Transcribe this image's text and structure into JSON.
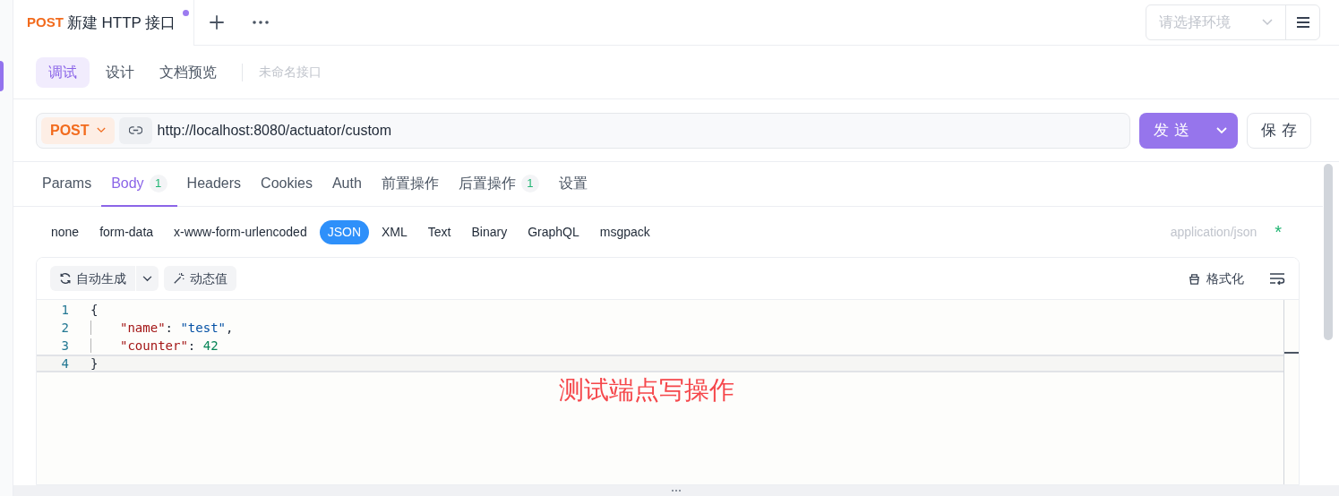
{
  "request_tab": {
    "method": "POST",
    "title": "新建 HTTP 接口",
    "unsaved": true
  },
  "env_select": {
    "placeholder": "请选择环境"
  },
  "mode_tabs": [
    {
      "label": "调试",
      "selected": true
    },
    {
      "label": "设计",
      "selected": false
    },
    {
      "label": "文档预览",
      "selected": false
    }
  ],
  "api_name": "未命名接口",
  "url_bar": {
    "method": "POST",
    "url": "http://localhost:8080/actuator/custom"
  },
  "send_button": "发送",
  "save_button": "保存",
  "request_tabs": [
    {
      "label": "Params",
      "selected": false
    },
    {
      "label": "Body",
      "badge": "1",
      "selected": true
    },
    {
      "label": "Headers",
      "selected": false
    },
    {
      "label": "Cookies",
      "selected": false
    },
    {
      "label": "Auth",
      "selected": false
    },
    {
      "label": "前置操作",
      "selected": false
    },
    {
      "label": "后置操作",
      "badge": "1",
      "selected": false
    },
    {
      "label": "设置",
      "selected": false
    }
  ],
  "body_types": [
    {
      "label": "none",
      "selected": false
    },
    {
      "label": "form-data",
      "selected": false
    },
    {
      "label": "x-www-form-urlencoded",
      "selected": false
    },
    {
      "label": "JSON",
      "selected": true
    },
    {
      "label": "XML",
      "selected": false
    },
    {
      "label": "Text",
      "selected": false
    },
    {
      "label": "Binary",
      "selected": false
    },
    {
      "label": "GraphQL",
      "selected": false
    },
    {
      "label": "msgpack",
      "selected": false
    }
  ],
  "content_type": "application/json",
  "required_mark": "*",
  "editor": {
    "auto_generate": "自动生成",
    "dynamic_value": "动态值",
    "format_button": "格式化",
    "lines": [
      {
        "number": "1",
        "indented": false,
        "active": false,
        "tokens": [
          {
            "kind": "punct",
            "text": "{"
          }
        ]
      },
      {
        "number": "2",
        "indented": true,
        "active": false,
        "tokens": [
          {
            "kind": "key",
            "text": "\"name\""
          },
          {
            "kind": "punct",
            "text": ": "
          },
          {
            "kind": "string",
            "text": "\"test\""
          },
          {
            "kind": "punct",
            "text": ","
          }
        ]
      },
      {
        "number": "3",
        "indented": true,
        "active": false,
        "tokens": [
          {
            "kind": "key",
            "text": "\"counter\""
          },
          {
            "kind": "punct",
            "text": ": "
          },
          {
            "kind": "number",
            "text": "42"
          }
        ]
      },
      {
        "number": "4",
        "indented": false,
        "active": true,
        "tokens": [
          {
            "kind": "punct",
            "text": "}"
          }
        ]
      }
    ]
  },
  "annotation": "测试端点写操作"
}
